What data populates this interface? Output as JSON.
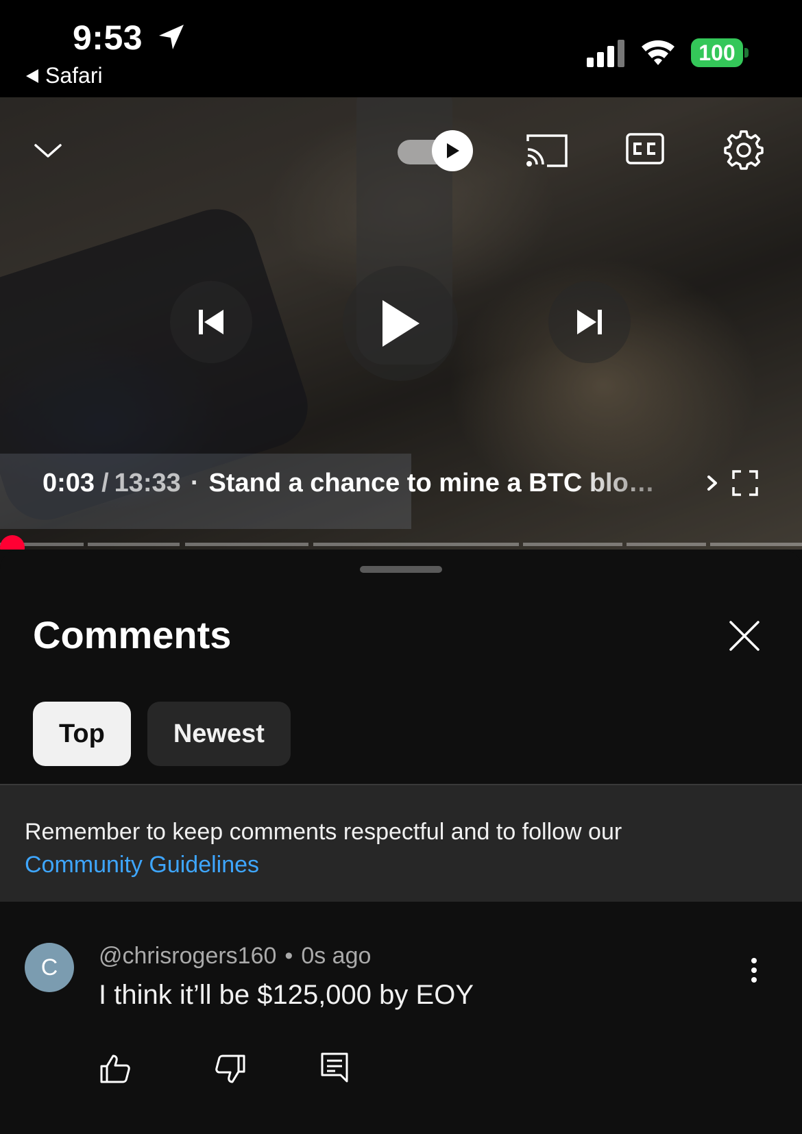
{
  "status_bar": {
    "time": "9:53",
    "back_app": "Safari",
    "battery": "100"
  },
  "player": {
    "current_time": "0:03",
    "separator": "/",
    "duration": "13:33",
    "dot": "·",
    "title": "Stand a chance to mine a BTC block with a Bitaxe",
    "progress_fraction": 0.002,
    "scrubber_color": "#ff0033"
  },
  "comments_panel": {
    "title": "Comments",
    "chips": [
      {
        "label": "Top",
        "active": true
      },
      {
        "label": "Newest",
        "active": false
      }
    ],
    "notice_text": "Remember to keep comments respectful and to follow our",
    "notice_link": "Community Guidelines",
    "link_color": "#3ea6ff"
  },
  "comments": [
    {
      "avatar_letter": "C",
      "author": "@chrisrogers160",
      "separator": "•",
      "age": "0s ago",
      "text": "I think it’ll be $125,000 by EOY"
    }
  ],
  "icons": {
    "collapse": "chevron-down-icon",
    "autoplay": "autoplay-toggle-icon",
    "cast": "cast-icon",
    "captions": "closed-captions-icon",
    "settings": "gear-icon",
    "previous": "skip-previous-icon",
    "play": "play-icon",
    "next": "skip-next-icon",
    "fullscreen": "fullscreen-icon",
    "close": "close-icon",
    "more": "more-vertical-icon",
    "like": "thumbs-up-icon",
    "dislike": "thumbs-down-icon",
    "reply": "reply-icon"
  }
}
